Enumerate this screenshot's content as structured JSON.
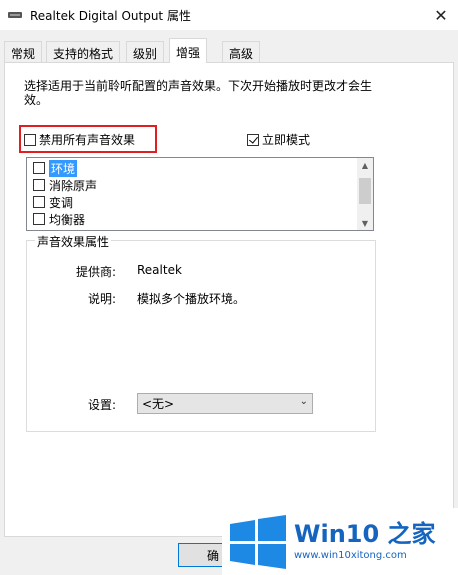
{
  "window": {
    "title": "Realtek Digital Output 属性"
  },
  "tabs": [
    {
      "label": "常规"
    },
    {
      "label": "支持的格式"
    },
    {
      "label": "级别"
    },
    {
      "label": "增强"
    },
    {
      "label": "高级"
    }
  ],
  "active_tab": "增强",
  "description": "选择适用于当前聆听配置的声音效果。下次开始播放时更改才会生效。",
  "disable_all": {
    "label": "禁用所有声音效果",
    "checked": false
  },
  "immediate_mode": {
    "label": "立即模式",
    "checked": true
  },
  "effects_list": [
    {
      "label": "环境",
      "checked": false,
      "selected": true
    },
    {
      "label": "消除原声",
      "checked": false,
      "selected": false
    },
    {
      "label": "变调",
      "checked": false,
      "selected": false
    },
    {
      "label": "均衡器",
      "checked": false,
      "selected": false
    }
  ],
  "properties": {
    "group_title": "声音效果属性",
    "provider_label": "提供商:",
    "provider_value": "Realtek",
    "description_label": "说明:",
    "description_value": "模拟多个播放环境。",
    "settings_label": "设置:",
    "settings_value": "<无>"
  },
  "buttons": {
    "ok_label": "确"
  },
  "watermark": {
    "brand": "Win10 之家",
    "url": "www.win10xitong.com"
  },
  "colors": {
    "highlight": "#e02020",
    "selection": "#3399ff",
    "brand": "#1565c0"
  }
}
